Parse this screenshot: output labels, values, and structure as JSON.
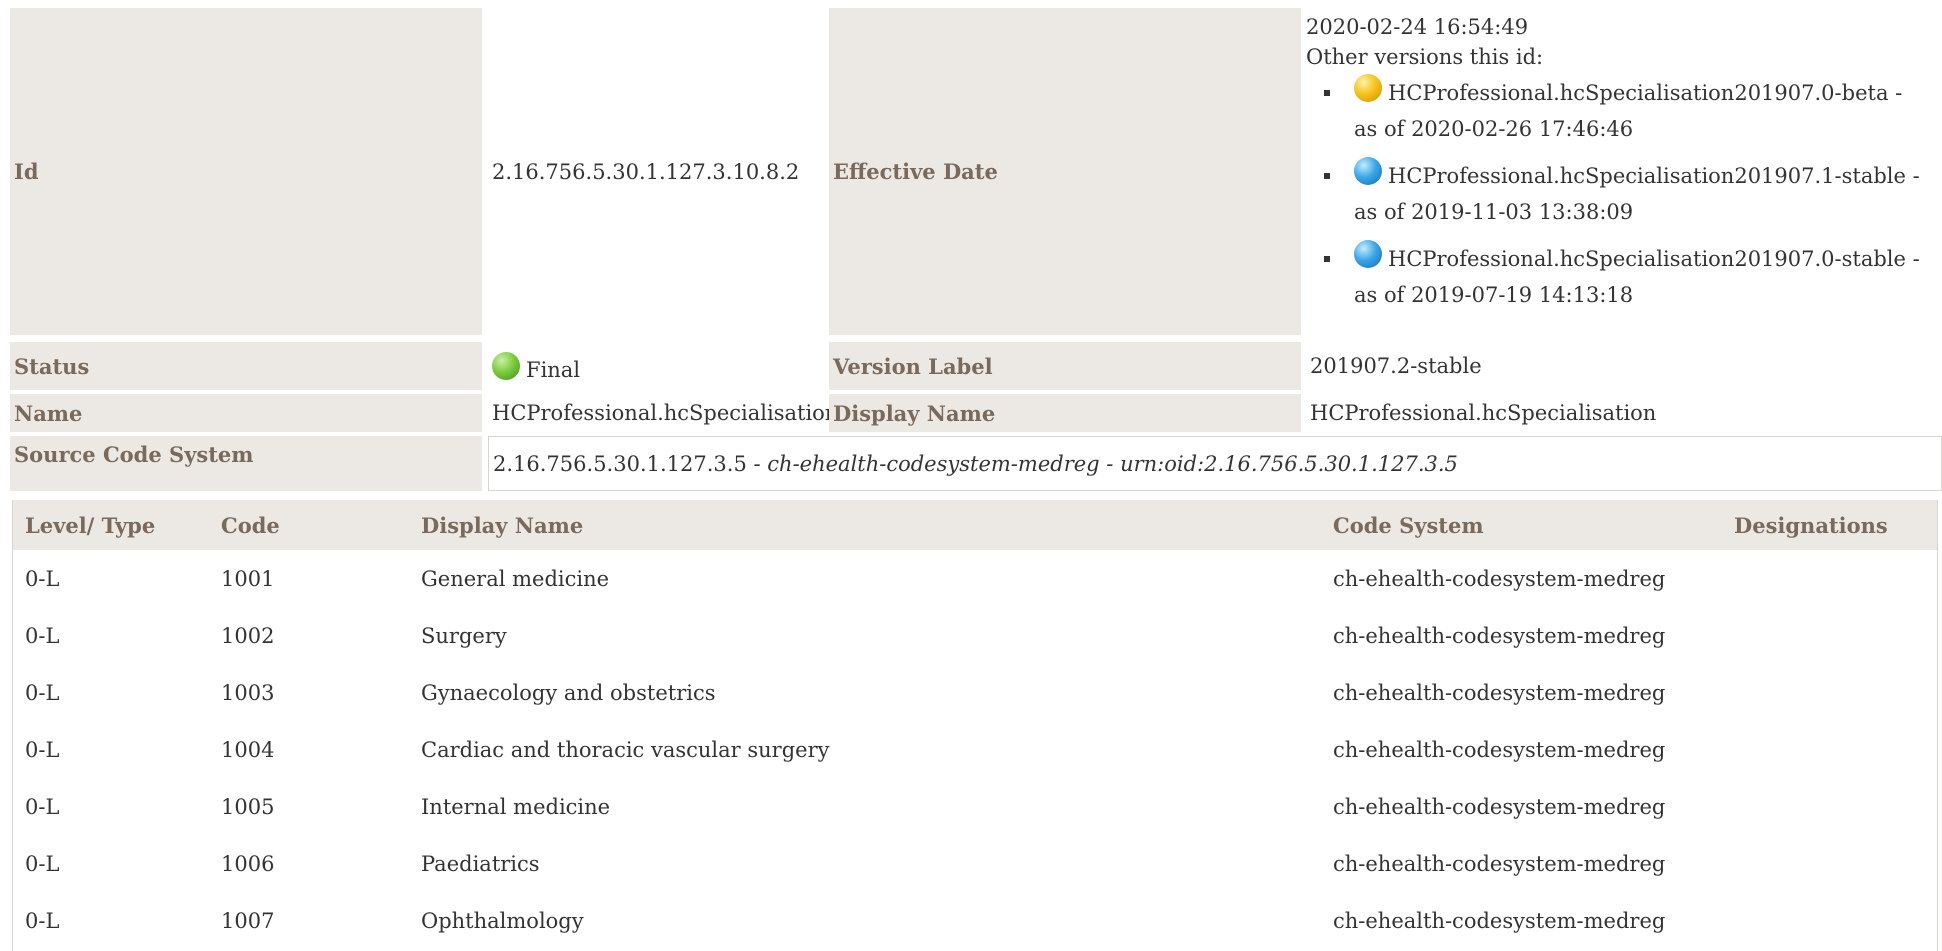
{
  "fields": {
    "id_label": "Id",
    "id_value": "2.16.756.5.30.1.127.3.10.8.2",
    "effective_date_label": "Effective Date",
    "effective_date_value": "2020-02-24 16:54:49",
    "other_versions_label": "Other versions this id:",
    "status_label": "Status",
    "status_value": "Final",
    "version_label_label": "Version Label",
    "version_label_value": "201907.2-stable",
    "name_label": "Name",
    "name_value": "HCProfessional.hcSpecialisation",
    "display_name_label": "Display Name",
    "display_name_value": "HCProfessional.hcSpecialisation",
    "source_code_system_label": "Source Code System",
    "source_code_system_id": "2.16.756.5.30.1.127.3.5",
    "source_sep1": " - ",
    "source_code_system_name": "ch-ehealth-codesystem-medreg",
    "source_sep2": " - ",
    "source_code_system_urn": "urn:oid:2.16.756.5.30.1.127.3.5"
  },
  "other_versions": [
    {
      "name": "HCProfessional.hcSpecialisation201907.0-beta -",
      "date": "as of 2020-02-26 17:46:46",
      "status_color": "#f7c21a",
      "status_icon": "yellow-ball-icon"
    },
    {
      "name": "HCProfessional.hcSpecialisation201907.1-stable -",
      "date": "as of 2019-11-03 13:38:09",
      "status_color": "#3aa7e8",
      "status_icon": "blue-ball-icon"
    },
    {
      "name": "HCProfessional.hcSpecialisation201907.0-stable -",
      "date": "as of 2019-07-19 14:13:18",
      "status_color": "#3aa7e8",
      "status_icon": "blue-ball-icon"
    }
  ],
  "status_icon": {
    "name": "green-ball-icon",
    "color": "#7ccc3e"
  },
  "table": {
    "headers": [
      "Level/ Type",
      "Code",
      "Display Name",
      "Code System",
      "Designations"
    ],
    "rows": [
      {
        "level": "0-L",
        "code": "1001",
        "display": "General medicine",
        "system": "ch-ehealth-codesystem-medreg"
      },
      {
        "level": "0-L",
        "code": "1002",
        "display": "Surgery",
        "system": "ch-ehealth-codesystem-medreg"
      },
      {
        "level": "0-L",
        "code": "1003",
        "display": "Gynaecology and obstetrics",
        "system": "ch-ehealth-codesystem-medreg"
      },
      {
        "level": "0-L",
        "code": "1004",
        "display": "Cardiac and thoracic vascular surgery",
        "system": "ch-ehealth-codesystem-medreg"
      },
      {
        "level": "0-L",
        "code": "1005",
        "display": "Internal medicine",
        "system": "ch-ehealth-codesystem-medreg"
      },
      {
        "level": "0-L",
        "code": "1006",
        "display": "Paediatrics",
        "system": "ch-ehealth-codesystem-medreg"
      },
      {
        "level": "0-L",
        "code": "1007",
        "display": "Ophthalmology",
        "system": "ch-ehealth-codesystem-medreg"
      }
    ]
  },
  "colors": {
    "label_bg": "#ece9e4",
    "label_text": "#7a6a5c"
  }
}
